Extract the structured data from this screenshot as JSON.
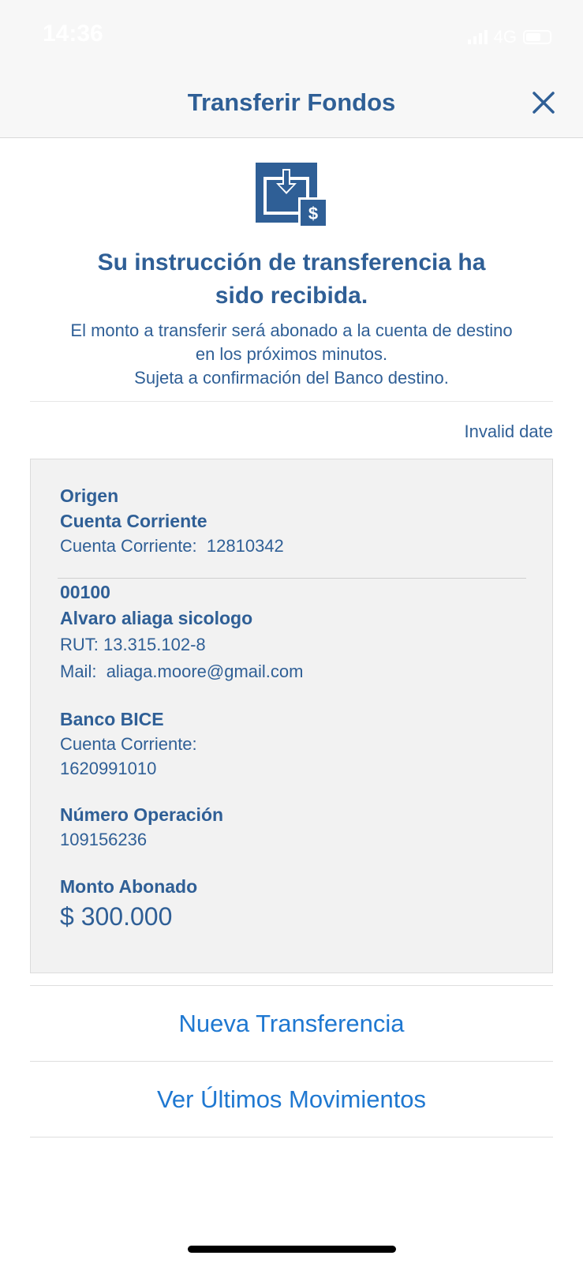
{
  "status_bar": {
    "time": "14:36",
    "network": "4G"
  },
  "nav": {
    "title": "Transferir Fondos",
    "close_icon": "close-icon"
  },
  "hero": {
    "icon": "transfer-money-icon",
    "headline_line1": "Su instrucción de transferencia ha",
    "headline_line2": "sido recibida.",
    "sub_line1": "El monto a transferir será abonado a la cuenta de destino",
    "sub_line2": "en los próximos minutos.",
    "sub_line3": "Sujeta a confirmación del Banco destino."
  },
  "date": "Invalid date",
  "origin": {
    "title": "Origen",
    "account_type": "Cuenta Corriente",
    "account_label": "Cuenta Corriente:",
    "account_number": "12810342"
  },
  "destination": {
    "code": "00100",
    "name": "Alvaro aliaga sicologo",
    "rut": "RUT: 13.315.102-8",
    "mail_label": "Mail:",
    "mail": "aliaga.moore@gmail.com",
    "bank": "Banco BICE",
    "account_label": "Cuenta Corriente:",
    "account_number": "1620991010"
  },
  "operation": {
    "label": "Número Operación",
    "number": "109156236"
  },
  "amount": {
    "label": "Monto Abonado",
    "value": "$ 300.000"
  },
  "actions": {
    "new_transfer": "Nueva Transferencia",
    "movements": "Ver Últimos Movimientos"
  },
  "colors": {
    "primary_text": "#2f5f96",
    "action_link": "#1f78d1",
    "card_bg": "#f2f2f2",
    "nav_bg": "#f7f7f7"
  }
}
